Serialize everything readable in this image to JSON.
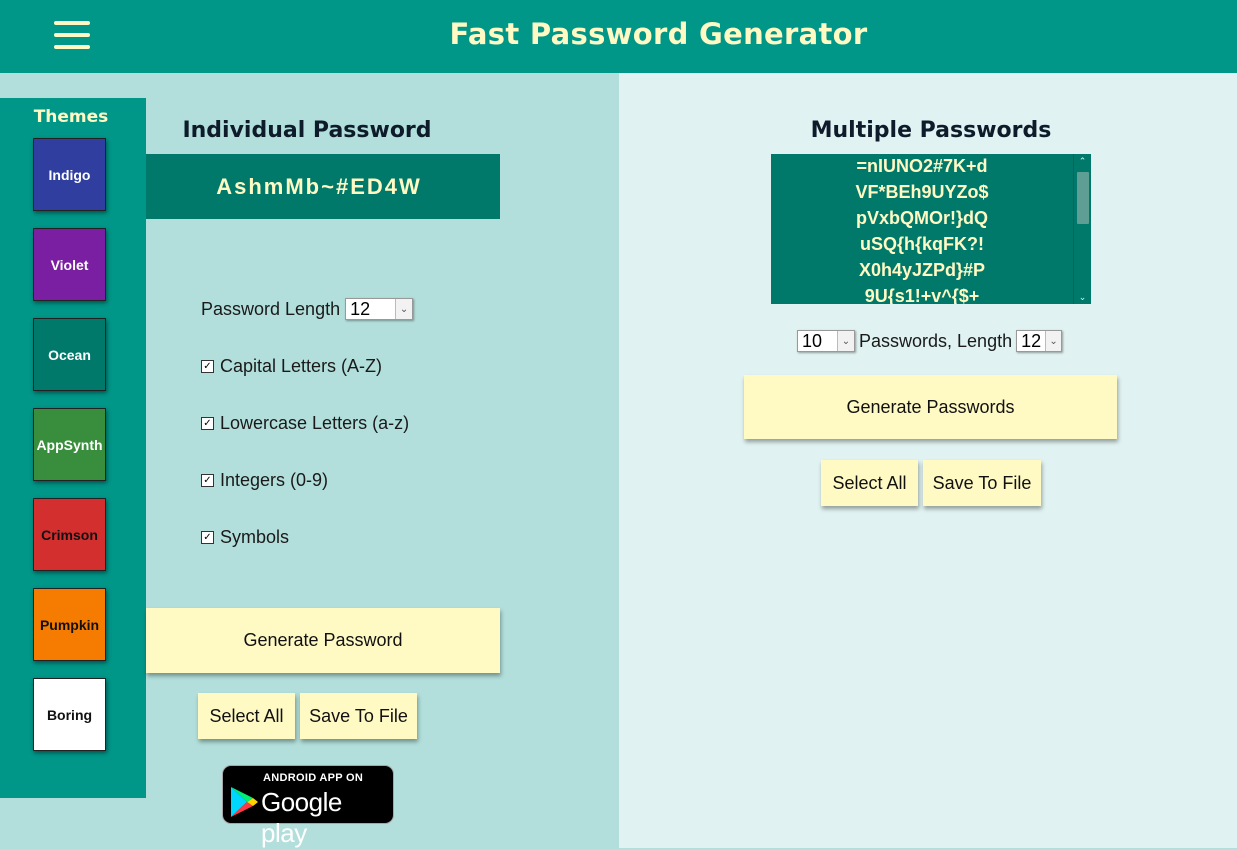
{
  "header": {
    "title": "Fast Password Generator"
  },
  "themes": {
    "title": "Themes",
    "items": [
      {
        "label": "Indigo",
        "color": "#303f9f",
        "text_color": "#ffffff"
      },
      {
        "label": "Violet",
        "color": "#7b1fa2",
        "text_color": "#ffffff"
      },
      {
        "label": "Ocean",
        "color": "#00796b",
        "text_color": "#ffffff"
      },
      {
        "label": "AppSynth",
        "color": "#388e3c",
        "text_color": "#ffffff"
      },
      {
        "label": "Crimson",
        "color": "#d32f2f",
        "text_color": "#111111"
      },
      {
        "label": "Pumpkin",
        "color": "#f57c00",
        "text_color": "#111111"
      },
      {
        "label": "Boring",
        "color": "#ffffff",
        "text_color": "#111111"
      }
    ]
  },
  "individual": {
    "title": "Individual Password",
    "password": "AshmMb~#ED4W",
    "length_label": "Password Length",
    "length_value": "12",
    "options": [
      {
        "label": "Capital Letters (A-Z)",
        "checked": true
      },
      {
        "label": "Lowercase Letters (a-z)",
        "checked": true
      },
      {
        "label": "Integers (0-9)",
        "checked": true
      },
      {
        "label": "Symbols",
        "checked": true
      }
    ],
    "generate_label": "Generate Password",
    "select_all_label": "Select All",
    "save_label": "Save To File"
  },
  "google_play": {
    "line1": "ANDROID APP ON",
    "line2": "Google play"
  },
  "multiple": {
    "title": "Multiple Passwords",
    "passwords": [
      "=nIUNO2#7K+d",
      "VF*BEh9UYZo$",
      "pVxbQMOr!}dQ",
      "uSQ{h{kqFK?!",
      "X0h4yJZPd}#P",
      "9U{s1!+v^{$+"
    ],
    "count_value": "10",
    "mid_label": "Passwords, Length",
    "length_value": "12",
    "generate_label": "Generate Passwords",
    "select_all_label": "Select All",
    "save_label": "Save To File"
  },
  "colors": {
    "primary": "#009688",
    "dark": "#00796b",
    "accent": "#fff9c4",
    "left_bg": "#b2dfdb",
    "right_bg": "#e0f2f1"
  }
}
